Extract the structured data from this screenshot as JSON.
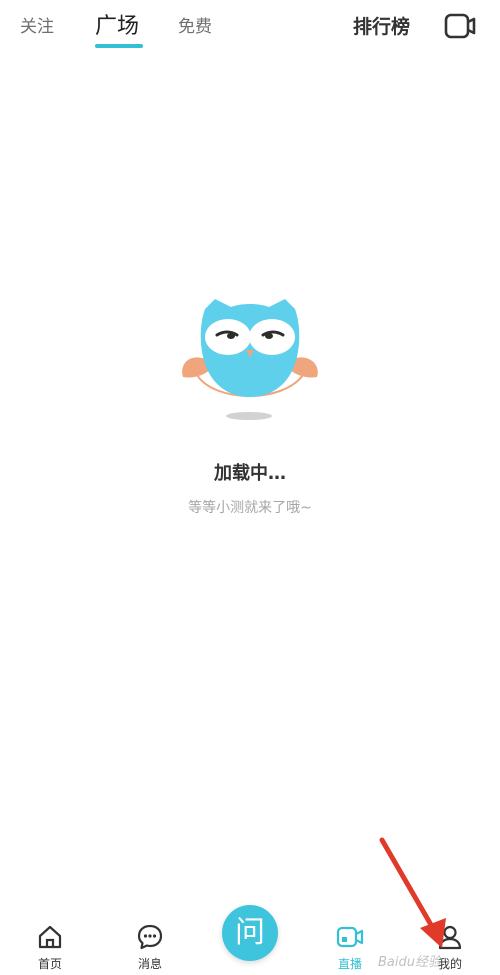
{
  "header": {
    "tabs": [
      {
        "label": "关注",
        "active": false
      },
      {
        "label": "广场",
        "active": true
      },
      {
        "label": "免费",
        "active": false
      }
    ],
    "ranking_label": "排行榜",
    "live_icon": "video-camera-icon"
  },
  "loading": {
    "mascot": "owl-mascot",
    "title": "加载中…",
    "subtitle": "等等小测就来了哦~"
  },
  "bottom_nav": {
    "items": [
      {
        "label": "首页",
        "icon": "home-icon"
      },
      {
        "label": "消息",
        "icon": "chat-bubble-icon"
      },
      {
        "label": "直播",
        "icon": "video-camera-icon"
      },
      {
        "label": "我的",
        "icon": "user-icon"
      }
    ],
    "center_button_label": "问"
  },
  "watermark": "Baidu经验",
  "colors": {
    "accent": "#34c0d4",
    "center_button": "#3ec4dc",
    "owl_body": "#5fd0ec",
    "owl_wing": "#f0a57c",
    "arrow": "#e03a2a"
  }
}
